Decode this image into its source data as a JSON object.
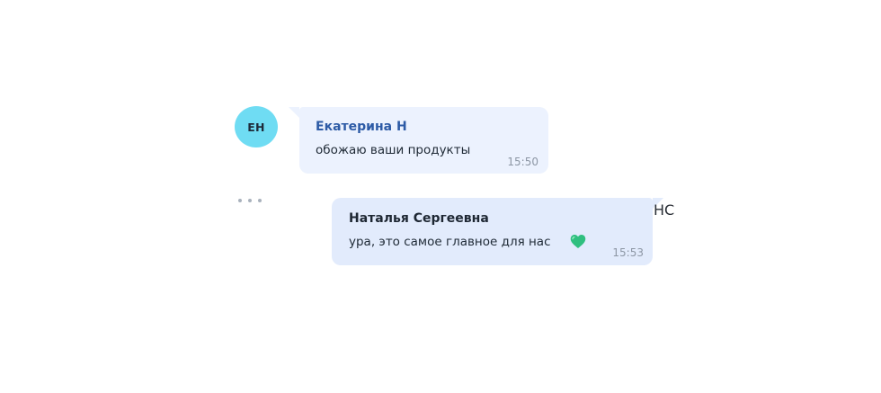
{
  "messages": {
    "incoming": {
      "avatar_initials": "ЕН",
      "sender": "Екатерина Н",
      "text": "обожаю ваши продукты",
      "time": "15:50",
      "avatar_color": "#6fdcf3",
      "sender_color": "#2d5ba6"
    },
    "outgoing": {
      "initials": "НС",
      "sender": "Наталья Сергеевна",
      "text": "ура, это самое главное для нас",
      "emoji_icon": "green-heart-icon",
      "time": "15:53"
    }
  },
  "menu": {
    "icon": "more-dots-icon"
  }
}
